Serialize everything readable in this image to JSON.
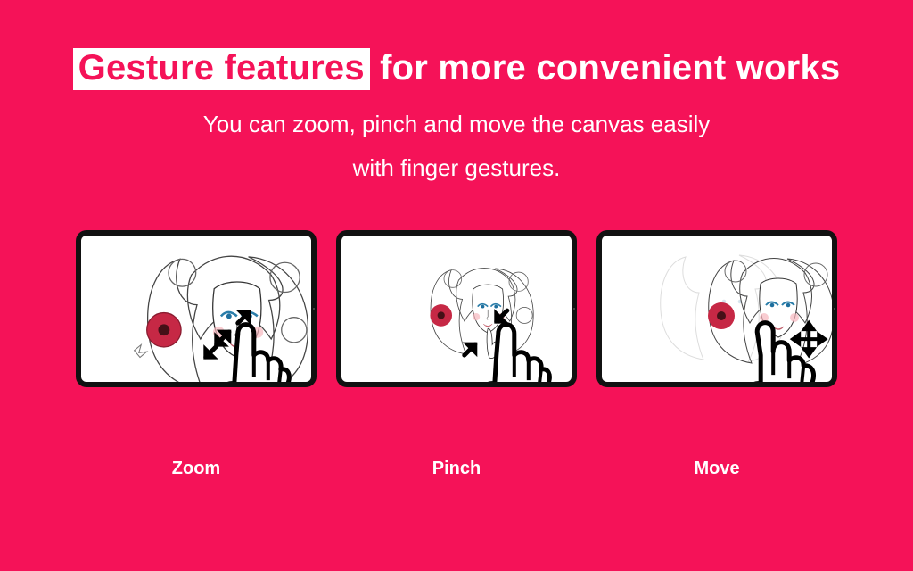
{
  "colors": {
    "bg": "#f51258",
    "accent": "#fff"
  },
  "headline": {
    "highlight": "Gesture features",
    "rest": "for more convenient works"
  },
  "sub_line1": "You can zoom, pinch and move the canvas easily",
  "sub_line2": "with finger gestures.",
  "tiles": {
    "zoom": {
      "label": "Zoom"
    },
    "pinch": {
      "label": "Pinch"
    },
    "move": {
      "label": "Move"
    }
  },
  "icons": {
    "zoom_gesture": "zoom-out-fingers-icon",
    "pinch_gesture": "pinch-in-fingers-icon",
    "move_gesture": "move-fingers-icon",
    "artwork": "woman-flowers-illustration"
  }
}
